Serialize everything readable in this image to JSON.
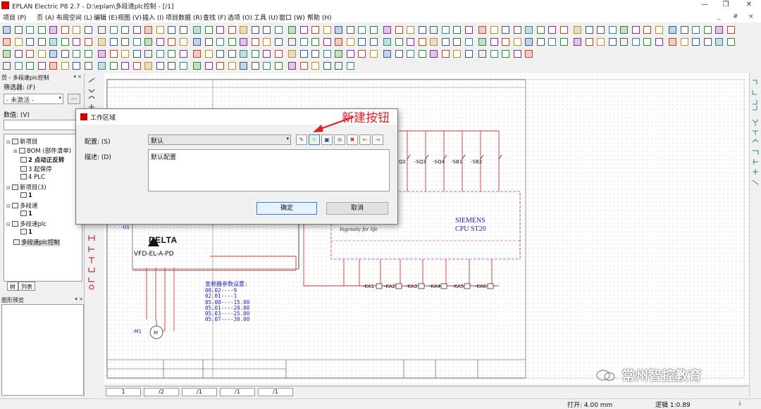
{
  "window": {
    "title": "EPLAN Electric P8 2.7 - D:\\eplan\\多段速plc控制 - [/1]",
    "controls": [
      "—",
      "❐",
      "✕"
    ],
    "mdi_controls": [
      "_",
      "#",
      "×"
    ]
  },
  "menu": [
    "项目 (P)",
    "页 (A)",
    "布局空间 (L)",
    "编辑 (E)",
    "视图 (V)",
    "插入 (I)",
    "项目数据 (R)",
    "查找 (F)",
    "选项 (O)",
    "工具 (U)",
    "窗口 (W)",
    "帮助 (H)"
  ],
  "left_panel": {
    "header": "页 - 多段速plc控制",
    "filter_label": "筛选器: (F)",
    "filter_value": "- 未激活 -",
    "filter_button": "...",
    "value_label": "数值: (V)",
    "tree": [
      {
        "label": "新项目",
        "indent": 0,
        "bold": false
      },
      {
        "label": "BOM (部件清单)",
        "indent": 1,
        "bold": false
      },
      {
        "label": "2 点动正反转",
        "indent": 1,
        "bold": true
      },
      {
        "label": "3 起保停",
        "indent": 1,
        "bold": false
      },
      {
        "label": "4 PLC",
        "indent": 1,
        "bold": false
      },
      {
        "label": "新项目(3)",
        "indent": 0,
        "bold": false
      },
      {
        "label": "1",
        "indent": 1,
        "bold": true
      },
      {
        "label": "多段速",
        "indent": 0,
        "bold": false
      },
      {
        "label": "1",
        "indent": 1,
        "bold": true
      },
      {
        "label": "多段速plc",
        "indent": 0,
        "bold": false
      },
      {
        "label": "1",
        "indent": 1,
        "bold": true
      },
      {
        "label": "多段速plc控制",
        "indent": 0,
        "bold": false,
        "selected": true
      }
    ],
    "tabs": [
      "树",
      "列表"
    ],
    "preview_header": "图形预览"
  },
  "dialog": {
    "title": "工作区域",
    "config_label": "配置: (S)",
    "config_value": "默认",
    "desc_label": "描述: (D)",
    "desc_value": "默认配置",
    "ok": "确定",
    "cancel": "取消"
  },
  "annotation": "新建按钮",
  "schematic": {
    "params_title": "变频器参数设置:",
    "params": [
      "00.02----9",
      "02.01----1",
      "05.00----15.00",
      "05.01----20.00",
      "05.03----25.00",
      "05.07----30.00"
    ],
    "vfd_brand": "DELTA",
    "vfd_model": "VFD-EL-A-PD",
    "vfd_tag": "-U1",
    "motor_tag": "-M1",
    "plc_brand": "SIEMENS",
    "plc_model": "CPU  ST20",
    "plc_slogan": "Ingenuity for life",
    "switch_labels": [
      "Q2",
      "-SQ3",
      "-SQ4",
      "-SB1",
      "-SB2"
    ],
    "relay_labels": [
      "-KA1",
      "-KA2",
      "-KA3",
      "-KA4",
      "-KA5",
      "-KA6"
    ]
  },
  "page_tabs": [
    "1",
    "/2",
    "/1",
    "/1",
    "/1"
  ],
  "status": {
    "open": "打开: 4.00 mm",
    "logic": "逻辑 1:0.89"
  },
  "watermark": "常州智控教育",
  "colors": {
    "accent": "#d40000",
    "wire": "#e03030",
    "plc_box": "#c020c0",
    "annotation": "#e0202a"
  }
}
